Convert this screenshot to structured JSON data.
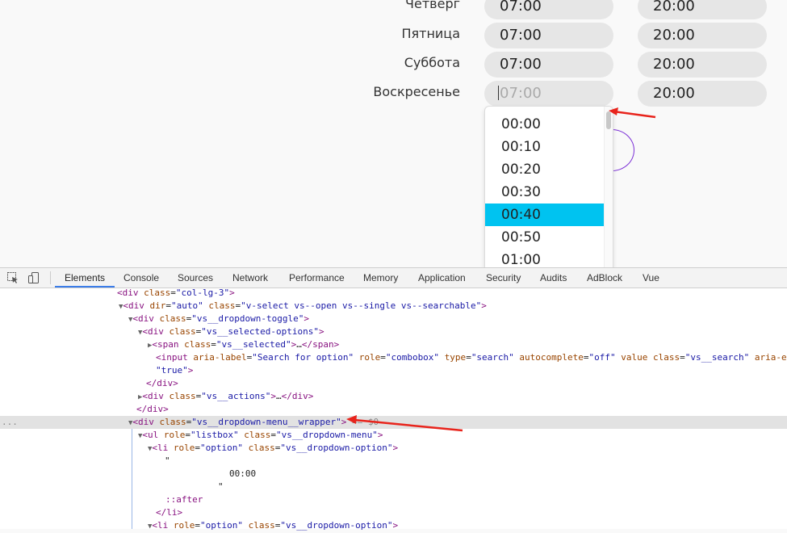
{
  "schedule": [
    {
      "day": "Четверг",
      "from": "07:00",
      "to": "20:00"
    },
    {
      "day": "Пятница",
      "from": "07:00",
      "to": "20:00"
    },
    {
      "day": "Суббота",
      "from": "07:00",
      "to": "20:00"
    },
    {
      "day": "Воскресенье",
      "from": "07:00",
      "to": "20:00"
    }
  ],
  "dropdown": {
    "options": [
      "00:00",
      "00:10",
      "00:20",
      "00:30",
      "00:40",
      "00:50",
      "01:00"
    ],
    "highlighted": "00:40"
  },
  "devtools": {
    "tabs": [
      "Elements",
      "Console",
      "Sources",
      "Network",
      "Performance",
      "Memory",
      "Application",
      "Security",
      "Audits",
      "AdBlock",
      "Vue"
    ],
    "active_tab": "Elements",
    "selected_marker": "== $0",
    "dots": "..."
  },
  "colors": {
    "highlight": "#00c3f0",
    "arrow": "#e8241c",
    "spinner": "#7b2fd6"
  }
}
